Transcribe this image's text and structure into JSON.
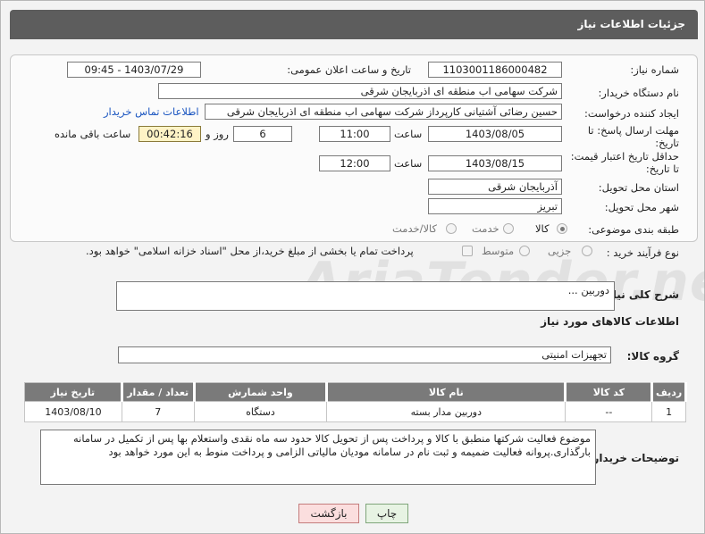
{
  "title": "جزئیات اطلاعات نیاز",
  "fields": {
    "need_number": {
      "label": "شماره نیاز:",
      "value": "1103001186000482"
    },
    "announce_datetime": {
      "label": "تاریخ و ساعت اعلان عمومی:",
      "value": "1403/07/29 - 09:45"
    },
    "buyer_org": {
      "label": "نام دستگاه خریدار:",
      "value": "شرکت سهامی اب منطقه ای اذربایجان شرقی"
    },
    "requester": {
      "label": "ایجاد کننده درخواست:",
      "value": "حسین رضائی آشتیانی کارپرداز شرکت سهامی اب منطقه ای اذربایجان شرقی"
    },
    "contact_link": "اطلاعات تماس خریدار",
    "reply_deadline": {
      "label": "مهلت ارسال پاسخ: تا تاریخ:",
      "date": "1403/08/05",
      "time_label": "ساعت",
      "time": "11:00",
      "days": "6",
      "days_label": "روز و",
      "remaining": "00:42:16",
      "remaining_label": "ساعت باقی مانده"
    },
    "price_validity": {
      "label": "حداقل تاریخ اعتبار قیمت: تا تاریخ:",
      "date": "1403/08/15",
      "time_label": "ساعت",
      "time": "12:00"
    },
    "province": {
      "label": "استان محل تحویل:",
      "value": "آذربایجان شرقی"
    },
    "city": {
      "label": "شهر محل تحویل:",
      "value": "تبریز"
    },
    "category": {
      "label": "طبقه بندی موضوعی:",
      "options": [
        "کالا",
        "خدمت",
        "کالا/خدمت"
      ],
      "selected": "کالا"
    },
    "process": {
      "label": "نوع فرآیند خرید :",
      "options": [
        "جزیی",
        "متوسط"
      ],
      "note": "پرداخت تمام یا بخشی از مبلغ خرید،از محل \"اسناد خزانه اسلامی\" خواهد بود."
    }
  },
  "summary": {
    "label": "شرح کلی نیاز:",
    "value": "دوربین ..."
  },
  "goods_section_title": "اطلاعات کالاهای مورد نیاز",
  "goods_group": {
    "label": "گروه کالا:",
    "value": "تجهیزات امنیتی"
  },
  "table": {
    "headers": [
      "ردیف",
      "کد کالا",
      "نام کالا",
      "واحد شمارش",
      "تعداد / مقدار",
      "تاریخ نیاز"
    ],
    "rows": [
      {
        "row": "1",
        "code": "--",
        "name": "دوربین مدار بسته",
        "unit": "دستگاه",
        "qty": "7",
        "date": "1403/08/10"
      }
    ]
  },
  "buyer_notes": {
    "label": "توضیحات خریدار:",
    "value": "موضوع فعالیت شرکتها منطبق با کالا و پرداخت پس از تحویل کالا حدود سه  ماه نقدی واستعلام بها پس از تکمیل در سامانه بارگذاری.پروانه فعالیت ضمیمه و ثبت نام در سامانه مودیان مالیاتی الزامی و پرداخت منوط به این مورد خواهد بود"
  },
  "buttons": {
    "print": "چاپ",
    "back": "بازگشت"
  },
  "watermark": "AriaTender.net"
}
